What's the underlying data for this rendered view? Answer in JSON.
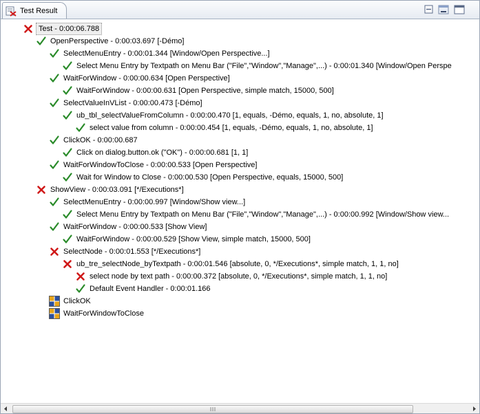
{
  "view": {
    "title": "Test Result"
  },
  "colors": {
    "passed": "#2a8b2a",
    "failed": "#d01818"
  },
  "status_icons": {
    "passed": "check-icon",
    "failed": "cross-icon",
    "notrun": "grid-icon"
  },
  "tree": [
    {
      "depth": 0,
      "status": "failed",
      "label": "Test - 0:00:06.788",
      "selected": true
    },
    {
      "depth": 1,
      "status": "passed",
      "label": "OpenPerspective - 0:00:03.697 [-Démo]"
    },
    {
      "depth": 2,
      "status": "passed",
      "label": "SelectMenuEntry - 0:00:01.344 [Window/Open Perspective...]"
    },
    {
      "depth": 3,
      "status": "passed",
      "label": "Select Menu Entry by Textpath on Menu Bar (\"File\",\"Window\",\"Manage\",...) - 0:00:01.340 [Window/Open Perspe"
    },
    {
      "depth": 2,
      "status": "passed",
      "label": "WaitForWindow - 0:00:00.634 [Open Perspective]"
    },
    {
      "depth": 3,
      "status": "passed",
      "label": "WaitForWindow - 0:00:00.631 [Open Perspective, simple match, 15000, 500]"
    },
    {
      "depth": 2,
      "status": "passed",
      "label": "SelectValueInVList - 0:00:00.473 [-Démo]"
    },
    {
      "depth": 3,
      "status": "passed",
      "label": "ub_tbl_selectValueFromColumn - 0:00:00.470 [1,  equals, -Démo, equals, 1,  no,  absolute, 1]"
    },
    {
      "depth": 4,
      "status": "passed",
      "label": "select value from column - 0:00:00.454 [1,  equals, -Démo, equals, 1,  no,  absolute, 1]"
    },
    {
      "depth": 2,
      "status": "passed",
      "label": "ClickOK - 0:00:00.687"
    },
    {
      "depth": 3,
      "status": "passed",
      "label": "Click on dialog.button.ok (\"OK\") - 0:00:00.681 [1, 1]"
    },
    {
      "depth": 2,
      "status": "passed",
      "label": "WaitForWindowToClose - 0:00:00.533 [Open Perspective]"
    },
    {
      "depth": 3,
      "status": "passed",
      "label": "Wait for Window to Close - 0:00:00.530 [Open Perspective, equals, 15000, 500]"
    },
    {
      "depth": 1,
      "status": "failed",
      "label": "ShowView - 0:00:03.091 [*/Executions*]"
    },
    {
      "depth": 2,
      "status": "passed",
      "label": "SelectMenuEntry - 0:00:00.997 [Window/Show view...]"
    },
    {
      "depth": 3,
      "status": "passed",
      "label": "Select Menu Entry by Textpath on Menu Bar (\"File\",\"Window\",\"Manage\",...) - 0:00:00.992 [Window/Show view..."
    },
    {
      "depth": 2,
      "status": "passed",
      "label": "WaitForWindow - 0:00:00.533 [Show View]"
    },
    {
      "depth": 3,
      "status": "passed",
      "label": "WaitForWindow - 0:00:00.529 [Show View, simple match, 15000, 500]"
    },
    {
      "depth": 2,
      "status": "failed",
      "label": "SelectNode - 0:00:01.553 [*/Executions*]"
    },
    {
      "depth": 3,
      "status": "failed",
      "label": "ub_tre_selectNode_byTextpath - 0:00:01.546 [absolute, 0, */Executions*, simple match, 1, 1, no]"
    },
    {
      "depth": 4,
      "status": "failed",
      "label": "select node by text path - 0:00:00.372 [absolute, 0, */Executions*, simple match, 1, 1, no]"
    },
    {
      "depth": 4,
      "status": "passed",
      "label": "Default Event Handler - 0:00:01.166"
    },
    {
      "depth": 2,
      "status": "notrun",
      "label": "ClickOK"
    },
    {
      "depth": 2,
      "status": "notrun",
      "label": "WaitForWindowToClose"
    }
  ]
}
